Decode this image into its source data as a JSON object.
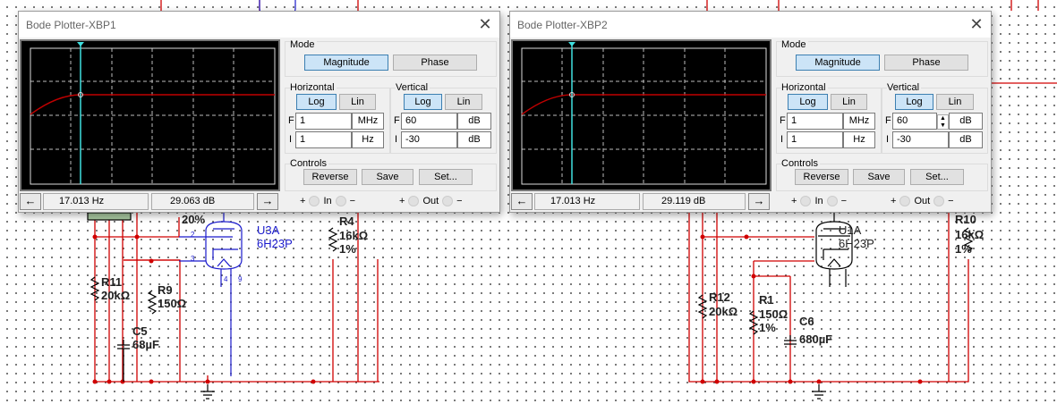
{
  "plotters": [
    {
      "title": "Bode Plotter-XBP1",
      "mode_label": "Mode",
      "magnitude": "Magnitude",
      "phase": "Phase",
      "horizontal": "Horizontal",
      "vertical": "Vertical",
      "log": "Log",
      "lin": "Lin",
      "h_final": "1",
      "h_final_unit": "MHz",
      "h_initial": "1",
      "h_initial_unit": "Hz",
      "v_final": "60",
      "v_final_unit": "dB",
      "v_initial": "-30",
      "v_initial_unit": "dB",
      "f_label": "F",
      "i_label": "I",
      "controls": "Controls",
      "reverse": "Reverse",
      "save": "Save",
      "set": "Set...",
      "cursor_freq": "17.013 Hz",
      "cursor_value": "29.063 dB",
      "plus": "+",
      "minus": "−",
      "in": "In",
      "out": "Out",
      "left_arrow": "←",
      "right_arrow": "→",
      "close": "✕"
    },
    {
      "title": "Bode Plotter-XBP2",
      "mode_label": "Mode",
      "magnitude": "Magnitude",
      "phase": "Phase",
      "horizontal": "Horizontal",
      "vertical": "Vertical",
      "log": "Log",
      "lin": "Lin",
      "h_final": "1",
      "h_final_unit": "MHz",
      "h_initial": "1",
      "h_initial_unit": "Hz",
      "v_final": "60",
      "v_final_unit": "dB",
      "v_initial": "-30",
      "v_initial_unit": "dB",
      "f_label": "F",
      "i_label": "I",
      "controls": "Controls",
      "reverse": "Reverse",
      "save": "Save",
      "set": "Set...",
      "cursor_freq": "17.013 Hz",
      "cursor_value": "29.119 dB",
      "plus": "+",
      "minus": "−",
      "in": "In",
      "out": "Out",
      "left_arrow": "←",
      "right_arrow": "→",
      "close": "✕"
    }
  ],
  "schematic": {
    "left": {
      "pot_pct": "20%",
      "tube_ref": "U3A",
      "tube_type": "6H23P",
      "pin2": "2",
      "pin3": "3",
      "pin4": "4",
      "pin9": "9",
      "r11_ref": "R11",
      "r11_val": "20kΩ",
      "r9_ref": "R9",
      "r9_val": "150Ω",
      "c5_ref": "C5",
      "c5_val": "68µF",
      "r4_ref": "R4",
      "r4_val": "16kΩ",
      "r4_tol": "1%"
    },
    "right": {
      "tube_ref": "U1A",
      "tube_type": "6H23P",
      "r12_ref": "R12",
      "r12_val": "20kΩ",
      "r1_ref": "R1",
      "r1_val": "150Ω",
      "r1_tol": "1%",
      "c6_ref": "C6",
      "c6_val": "680µF",
      "r10_ref": "R10",
      "r10_val": "16kΩ",
      "r10_tol": "1%"
    }
  },
  "colors": {
    "wire": "#d00000",
    "component": "#000000",
    "selected": "#1a1acc",
    "trace": "#c00000",
    "cursor": "#40e0e0",
    "button_active": "#cce4f7"
  }
}
